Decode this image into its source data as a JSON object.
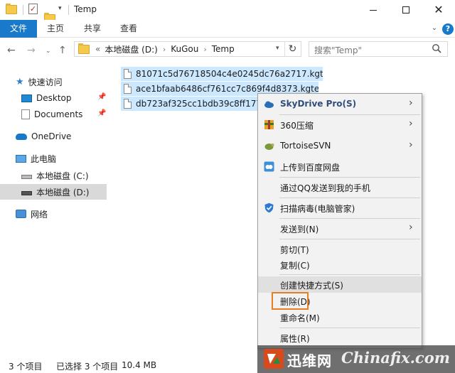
{
  "window": {
    "title": "Temp"
  },
  "ribbon": {
    "tabs": [
      "文件",
      "主页",
      "共享",
      "查看"
    ]
  },
  "address": {
    "root_glyph": "«",
    "crumbs": [
      "本地磁盘 (D:)",
      "KuGou",
      "Temp"
    ],
    "search_placeholder": "搜索\"Temp\""
  },
  "sidebar": {
    "items": [
      {
        "label": "快速访问",
        "icon": "star-icon"
      },
      {
        "label": "Desktop",
        "icon": "desktop-icon",
        "pinned": true
      },
      {
        "label": "Documents",
        "icon": "documents-icon",
        "pinned": true
      },
      {
        "label": "OneDrive",
        "icon": "cloud-icon"
      },
      {
        "label": "此电脑",
        "icon": "computer-icon"
      },
      {
        "label": "本地磁盘 (C:)",
        "icon": "drive-icon"
      },
      {
        "label": "本地磁盘 (D:)",
        "icon": "drive-icon",
        "selected": true
      },
      {
        "label": "网络",
        "icon": "network-icon"
      }
    ]
  },
  "files": [
    {
      "name": "81071c5d76718504c4e0245dc76a2717.kgtemp"
    },
    {
      "name": "ace1bfaab6486cf761cc7c869f4d8373.kgtemp"
    },
    {
      "name": "db723af325cc1bdb39c8ff177c4"
    }
  ],
  "context_menu": {
    "items": [
      {
        "label": "SkyDrive Pro(S)",
        "icon": "skydrive-icon",
        "submenu": true,
        "bold": true
      },
      {
        "label": "360压缩",
        "icon": "zip-360-icon",
        "submenu": true
      },
      {
        "label": "TortoiseSVN",
        "icon": "tortoise-icon",
        "submenu": true
      },
      {
        "label": "上传到百度网盘",
        "icon": "baidu-cloud-icon"
      },
      {
        "label": "通过QQ发送到我的手机",
        "icon": ""
      },
      {
        "label": "扫描病毒(电脑管家)",
        "icon": "shield-scan-icon"
      },
      {
        "label": "发送到(N)",
        "icon": "",
        "submenu": true
      },
      {
        "label": "剪切(T)",
        "icon": ""
      },
      {
        "label": "复制(C)",
        "icon": ""
      },
      {
        "label": "创建快捷方式(S)",
        "icon": "",
        "hover": true
      },
      {
        "label": "删除(D)",
        "icon": "",
        "highlighted": true
      },
      {
        "label": "重命名(M)",
        "icon": ""
      },
      {
        "label": "属性(R)",
        "icon": ""
      }
    ],
    "highlight_color": "#e87e1e"
  },
  "status": {
    "count": "3 个项目",
    "selected": "已选择 3 个项目",
    "size": "10.4 MB"
  },
  "watermark": {
    "text_cn": "迅维网",
    "text_en": "Chinafix.com"
  },
  "colors": {
    "accent": "#1979ca",
    "selection": "#cce8ff"
  }
}
